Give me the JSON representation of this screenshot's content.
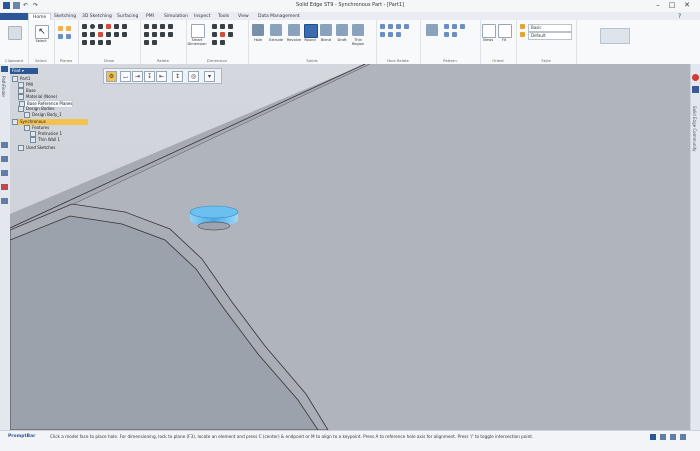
{
  "window": {
    "title": "Solid Edge ST9 - Synchronous Part - [Part1]"
  },
  "tabs": [
    {
      "label": "Home",
      "active": true
    },
    {
      "label": "Sketching"
    },
    {
      "label": "3D Sketching"
    },
    {
      "label": "Surfacing"
    },
    {
      "label": "PMI"
    },
    {
      "label": "Simulation"
    },
    {
      "label": "Inspect"
    },
    {
      "label": "Tools"
    },
    {
      "label": "View"
    },
    {
      "label": "Data Management"
    }
  ],
  "ribbon": {
    "groups": [
      {
        "label": "Clipboard"
      },
      {
        "label": "Select"
      },
      {
        "label": "Planes"
      },
      {
        "label": "Draw"
      },
      {
        "label": "Relate"
      },
      {
        "label": "Dimension"
      },
      {
        "label": "Solids"
      },
      {
        "label": "Face Relate"
      },
      {
        "label": "Pattern"
      },
      {
        "label": "Orient"
      },
      {
        "label": "Style"
      }
    ],
    "big_buttons": {
      "select": "Select",
      "smart_dimension": "Smart Dimension",
      "hole": "Hole",
      "extrude": "Extrude",
      "revolve": "Revolve",
      "round": "Round",
      "blend": "Blend",
      "draft": "Draft",
      "thin_region": "Thin Region",
      "views": "Views",
      "fit": "Fit"
    },
    "style_dropdown": {
      "label": "Basic",
      "value": "Default"
    }
  },
  "pathfinder": {
    "items": [
      {
        "label": "Part1",
        "level": 0
      },
      {
        "label": "PMI",
        "level": 1
      },
      {
        "label": "Base",
        "level": 1
      },
      {
        "label": "Material (None)",
        "level": 1
      },
      {
        "label": "Base Reference Planes",
        "level": 1
      },
      {
        "label": "Design Bodies",
        "level": 1
      },
      {
        "label": "Design Body_1",
        "level": 2
      },
      {
        "label": "Synchronous",
        "level": 1,
        "highlight": true
      },
      {
        "label": "Features",
        "level": 2
      },
      {
        "label": "Protrusion 1",
        "level": 3
      },
      {
        "label": "Thin Wall 1",
        "level": 3
      },
      {
        "label": "Used Sketches",
        "level": 1
      }
    ]
  },
  "right_panel": {
    "label": "Solid Edge Community"
  },
  "left_panel": {
    "label": "PathFinder"
  },
  "status": {
    "brand": "PromptBar",
    "prompt": "Click a model face to place hole. For dimensioning, lock to plane (F3), locate an element and press C (center) & endpoint or M to align to a keypoint. Press A to reference hole axis for alignment. Press '/' to toggle intersection point."
  },
  "colors": {
    "model_face": "#b0b5bd",
    "hole": "#56b4ec",
    "highlight": "#f2c14e",
    "accent": "#2b5797"
  }
}
